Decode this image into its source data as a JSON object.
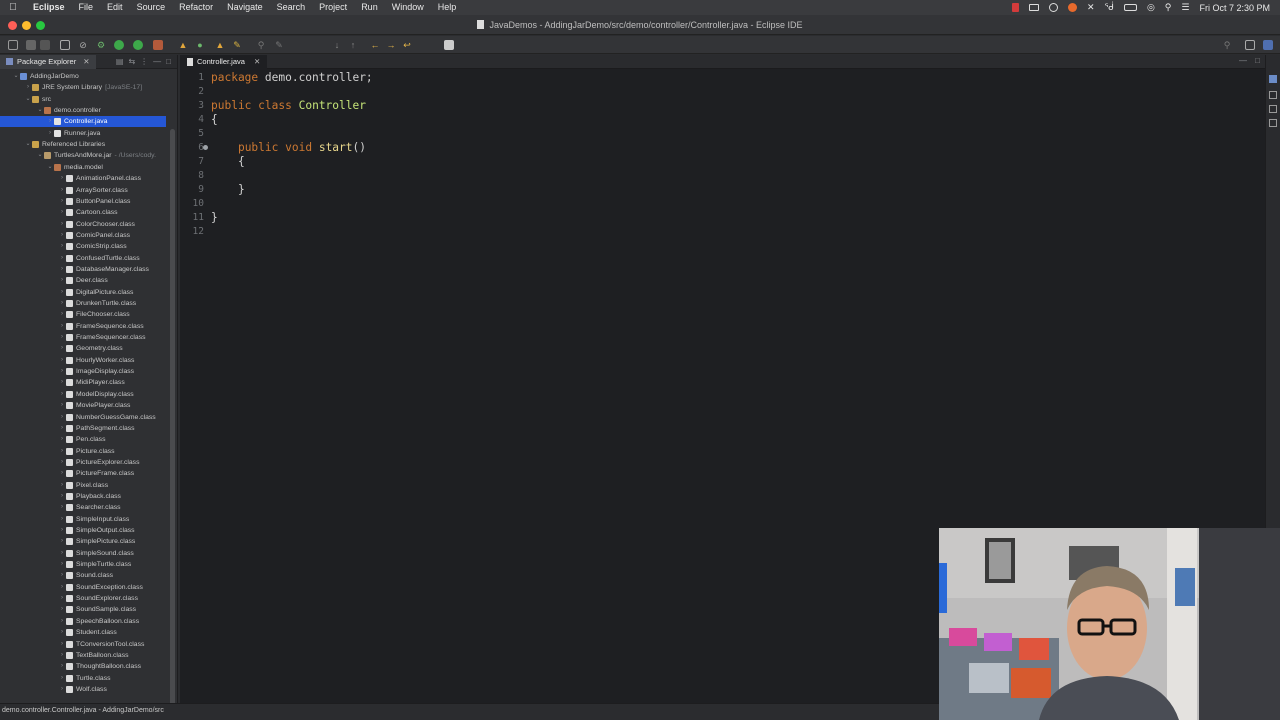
{
  "menubar": {
    "app_name": "Eclipse",
    "items": [
      "File",
      "Edit",
      "Source",
      "Refactor",
      "Navigate",
      "Search",
      "Project",
      "Run",
      "Window",
      "Help"
    ],
    "clock": "Fri Oct 7  2:30 PM"
  },
  "window": {
    "title": "JavaDemos - AddingJarDemo/src/demo/controller/Controller.java - Eclipse IDE"
  },
  "explorer": {
    "tab_label": "Package Explorer",
    "nodes": [
      {
        "label": "AddingJarDemo",
        "extra": "",
        "icon": "project-icon",
        "twisty": "open"
      },
      {
        "label": "JRE System Library",
        "extra": "[JavaSE-17]",
        "icon": "library-icon",
        "twisty": "closed"
      },
      {
        "label": "src",
        "extra": "",
        "icon": "source-folder-icon",
        "twisty": "open"
      },
      {
        "label": "demo.controller",
        "extra": "",
        "icon": "package-icon",
        "twisty": "open"
      },
      {
        "label": "Controller.java",
        "extra": "",
        "icon": "java-file-icon",
        "twisty": "closed"
      },
      {
        "label": "Runner.java",
        "extra": "",
        "icon": "java-file-icon",
        "twisty": "closed"
      },
      {
        "label": "Referenced Libraries",
        "extra": "",
        "icon": "library-icon",
        "twisty": "open"
      },
      {
        "label": "TurtlesAndMore.jar",
        "extra": "- /Users/cody.",
        "icon": "jar-icon",
        "twisty": "open"
      },
      {
        "label": "media.model",
        "extra": "",
        "icon": "package-icon",
        "twisty": "open"
      },
      {
        "label": "AnimationPanel.class",
        "extra": "",
        "icon": "class-file-icon",
        "twisty": "closed"
      },
      {
        "label": "ArraySorter.class",
        "extra": "",
        "icon": "class-file-icon",
        "twisty": "closed"
      },
      {
        "label": "ButtonPanel.class",
        "extra": "",
        "icon": "class-file-icon",
        "twisty": "closed"
      },
      {
        "label": "Cartoon.class",
        "extra": "",
        "icon": "class-file-icon",
        "twisty": "closed"
      },
      {
        "label": "ColorChooser.class",
        "extra": "",
        "icon": "class-file-icon",
        "twisty": "closed"
      },
      {
        "label": "ComicPanel.class",
        "extra": "",
        "icon": "class-file-icon",
        "twisty": "closed"
      },
      {
        "label": "ComicStrip.class",
        "extra": "",
        "icon": "class-file-icon",
        "twisty": "closed"
      },
      {
        "label": "ConfusedTurtle.class",
        "extra": "",
        "icon": "class-file-icon",
        "twisty": "closed"
      },
      {
        "label": "DatabaseManager.class",
        "extra": "",
        "icon": "class-file-icon",
        "twisty": "closed"
      },
      {
        "label": "Deer.class",
        "extra": "",
        "icon": "class-file-icon",
        "twisty": "closed"
      },
      {
        "label": "DigitalPicture.class",
        "extra": "",
        "icon": "class-file-icon",
        "twisty": "closed"
      },
      {
        "label": "DrunkenTurtle.class",
        "extra": "",
        "icon": "class-file-icon",
        "twisty": "closed"
      },
      {
        "label": "FileChooser.class",
        "extra": "",
        "icon": "class-file-icon",
        "twisty": "closed"
      },
      {
        "label": "FrameSequence.class",
        "extra": "",
        "icon": "class-file-icon",
        "twisty": "closed"
      },
      {
        "label": "FrameSequencer.class",
        "extra": "",
        "icon": "class-file-icon",
        "twisty": "closed"
      },
      {
        "label": "Geometry.class",
        "extra": "",
        "icon": "class-file-icon",
        "twisty": "closed"
      },
      {
        "label": "HourlyWorker.class",
        "extra": "",
        "icon": "class-file-icon",
        "twisty": "closed"
      },
      {
        "label": "ImageDisplay.class",
        "extra": "",
        "icon": "class-file-icon",
        "twisty": "closed"
      },
      {
        "label": "MidiPlayer.class",
        "extra": "",
        "icon": "class-file-icon",
        "twisty": "closed"
      },
      {
        "label": "ModelDisplay.class",
        "extra": "",
        "icon": "class-file-icon",
        "twisty": "closed"
      },
      {
        "label": "MoviePlayer.class",
        "extra": "",
        "icon": "class-file-icon",
        "twisty": "closed"
      },
      {
        "label": "NumberGuessGame.class",
        "extra": "",
        "icon": "class-file-icon",
        "twisty": "closed"
      },
      {
        "label": "PathSegment.class",
        "extra": "",
        "icon": "class-file-icon",
        "twisty": "closed"
      },
      {
        "label": "Pen.class",
        "extra": "",
        "icon": "class-file-icon",
        "twisty": "closed"
      },
      {
        "label": "Picture.class",
        "extra": "",
        "icon": "class-file-icon",
        "twisty": "closed"
      },
      {
        "label": "PictureExplorer.class",
        "extra": "",
        "icon": "class-file-icon",
        "twisty": "closed"
      },
      {
        "label": "PictureFrame.class",
        "extra": "",
        "icon": "class-file-icon",
        "twisty": "closed"
      },
      {
        "label": "Pixel.class",
        "extra": "",
        "icon": "class-file-icon",
        "twisty": "closed"
      },
      {
        "label": "Playback.class",
        "extra": "",
        "icon": "class-file-icon",
        "twisty": "closed"
      },
      {
        "label": "Searcher.class",
        "extra": "",
        "icon": "class-file-icon",
        "twisty": "closed"
      },
      {
        "label": "SimpleInput.class",
        "extra": "",
        "icon": "class-file-icon",
        "twisty": "closed"
      },
      {
        "label": "SimpleOutput.class",
        "extra": "",
        "icon": "class-file-icon",
        "twisty": "closed"
      },
      {
        "label": "SimplePicture.class",
        "extra": "",
        "icon": "class-file-icon",
        "twisty": "closed"
      },
      {
        "label": "SimpleSound.class",
        "extra": "",
        "icon": "class-file-icon",
        "twisty": "closed"
      },
      {
        "label": "SimpleTurtle.class",
        "extra": "",
        "icon": "class-file-icon",
        "twisty": "closed"
      },
      {
        "label": "Sound.class",
        "extra": "",
        "icon": "class-file-icon",
        "twisty": "closed"
      },
      {
        "label": "SoundException.class",
        "extra": "",
        "icon": "class-file-icon",
        "twisty": "closed"
      },
      {
        "label": "SoundExplorer.class",
        "extra": "",
        "icon": "class-file-icon",
        "twisty": "closed"
      },
      {
        "label": "SoundSample.class",
        "extra": "",
        "icon": "class-file-icon",
        "twisty": "closed"
      },
      {
        "label": "SpeechBalloon.class",
        "extra": "",
        "icon": "class-file-icon",
        "twisty": "closed"
      },
      {
        "label": "Student.class",
        "extra": "",
        "icon": "class-file-icon",
        "twisty": "closed"
      },
      {
        "label": "TConversionTool.class",
        "extra": "",
        "icon": "class-file-icon",
        "twisty": "closed"
      },
      {
        "label": "TextBalloon.class",
        "extra": "",
        "icon": "class-file-icon",
        "twisty": "closed"
      },
      {
        "label": "ThoughtBalloon.class",
        "extra": "",
        "icon": "class-file-icon",
        "twisty": "closed"
      },
      {
        "label": "Turtle.class",
        "extra": "",
        "icon": "class-file-icon",
        "twisty": "closed"
      },
      {
        "label": "Wolf.class",
        "extra": "",
        "icon": "class-file-icon",
        "twisty": "closed"
      }
    ],
    "selected_label": "Controller.java"
  },
  "editor": {
    "tab_label": "Controller.java",
    "line_numbers": [
      "1",
      "2",
      "3",
      "4",
      "5",
      "6",
      "7",
      "8",
      "9",
      "10",
      "11",
      "12"
    ],
    "lines": [
      [
        {
          "t": "package",
          "c": "kw"
        },
        {
          "t": " demo.controller;",
          "c": ""
        }
      ],
      [],
      [
        {
          "t": "public",
          "c": "kw"
        },
        {
          "t": " ",
          "c": ""
        },
        {
          "t": "class",
          "c": "kw"
        },
        {
          "t": " ",
          "c": ""
        },
        {
          "t": "Controller",
          "c": "cls"
        }
      ],
      [
        {
          "t": "{",
          "c": ""
        }
      ],
      [],
      [
        {
          "t": "    ",
          "c": ""
        },
        {
          "t": "public",
          "c": "kw"
        },
        {
          "t": " ",
          "c": ""
        },
        {
          "t": "void",
          "c": "kw"
        },
        {
          "t": " ",
          "c": ""
        },
        {
          "t": "start",
          "c": "meth"
        },
        {
          "t": "()",
          "c": ""
        }
      ],
      [
        {
          "t": "    {",
          "c": ""
        }
      ],
      [],
      [
        {
          "t": "    }",
          "c": ""
        }
      ],
      [],
      [
        {
          "t": "}",
          "c": ""
        }
      ],
      []
    ]
  },
  "statusbar": {
    "text": "demo.controller.Controller.java - AddingJarDemo/src"
  },
  "colors": {
    "keyword": "#cc7832",
    "class_name": "#c5e478",
    "method_name": "#e7d68c",
    "selection": "#2557d6"
  }
}
